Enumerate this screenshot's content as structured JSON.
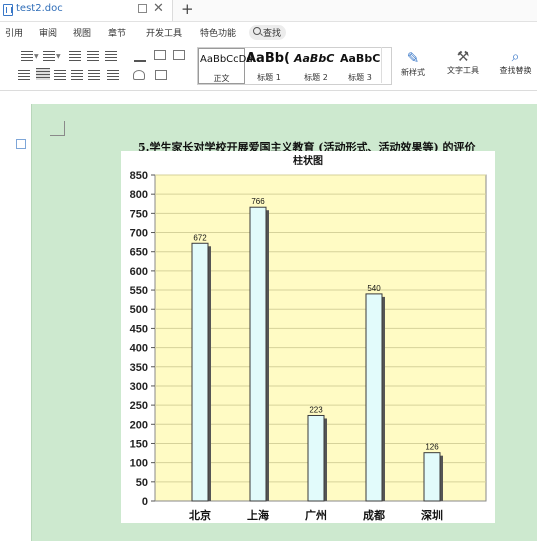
{
  "tab": {
    "title": "test2.doc",
    "new_tab": "+"
  },
  "menu": [
    "引用",
    "审阅",
    "视图",
    "章节",
    "开发工具",
    "特色功能"
  ],
  "search": {
    "label": "查找"
  },
  "styles": [
    {
      "preview": "AaBbCcDd",
      "name": "正文"
    },
    {
      "preview": "AaBb(",
      "name": "标题 1"
    },
    {
      "preview": "AaBbC",
      "name": "标题 2"
    },
    {
      "preview": "AaBbC(",
      "name": "标题 3"
    }
  ],
  "tools": {
    "new_style": "新样式",
    "text_tools": "文字工具",
    "find_replace": "查找替换"
  },
  "caption": "5.学生家长对学校开展爱国主义教育 (活动形式、活动效果等) 的评价",
  "chart_data": {
    "type": "bar",
    "title": "柱状图",
    "categories": [
      "北京",
      "上海",
      "广州",
      "成都",
      "深圳"
    ],
    "values": [
      672,
      766,
      223,
      540,
      126
    ],
    "ylim": [
      0,
      850
    ],
    "yticks": [
      0,
      50,
      100,
      150,
      200,
      250,
      300,
      350,
      400,
      450,
      500,
      550,
      600,
      650,
      700,
      750,
      800,
      850
    ],
    "grid": true,
    "plot_bg": "#fffbc4",
    "bar_color": "#e2fbfb",
    "bar_edge": "#3a3a3a"
  },
  "colors": {
    "page_bg": "#cde9cf",
    "accent": "#2f6db8"
  }
}
